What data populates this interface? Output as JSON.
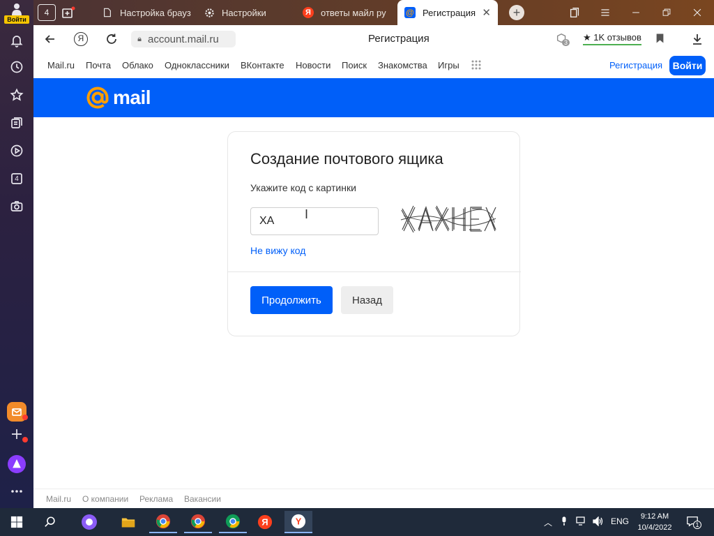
{
  "sidebar": {
    "login_label": "Войти",
    "tab_count": "4"
  },
  "tabs": [
    {
      "title": "Настройка брауз",
      "icon": "page-icon"
    },
    {
      "title": "Настройки",
      "icon": "gear-icon"
    },
    {
      "title": "ответы майл ру",
      "icon": "yandex-icon"
    },
    {
      "title": "Регистрация",
      "icon": "mail-at-icon"
    }
  ],
  "tabstrip": {
    "tab_counter": "4"
  },
  "addressbar": {
    "url": "account.mail.ru",
    "page_title": "Регистрация",
    "reviews_label": "★ 1K отзывов",
    "ext_badge": "3"
  },
  "sitenav": {
    "items": [
      "Mail.ru",
      "Почта",
      "Облако",
      "Одноклассники",
      "ВКонтакте",
      "Новости",
      "Поиск",
      "Знакомства",
      "Игры"
    ],
    "register": "Регистрация",
    "login": "Войти"
  },
  "brand": {
    "word": "mail",
    "color": "#005ff9",
    "accent": "#ff9e00"
  },
  "card": {
    "title": "Создание почтового ящика",
    "label": "Укажите код с картинки",
    "input_value": "XA",
    "no_code_link": "Не вижу код",
    "continue_label": "Продолжить",
    "back_label": "Назад"
  },
  "footer": {
    "links": [
      "Mail.ru",
      "О компании",
      "Реклама",
      "Вакансии"
    ]
  },
  "taskbar": {
    "lang": "ENG",
    "time": "9:12 AM",
    "date": "10/4/2022",
    "notif_count": "1"
  }
}
